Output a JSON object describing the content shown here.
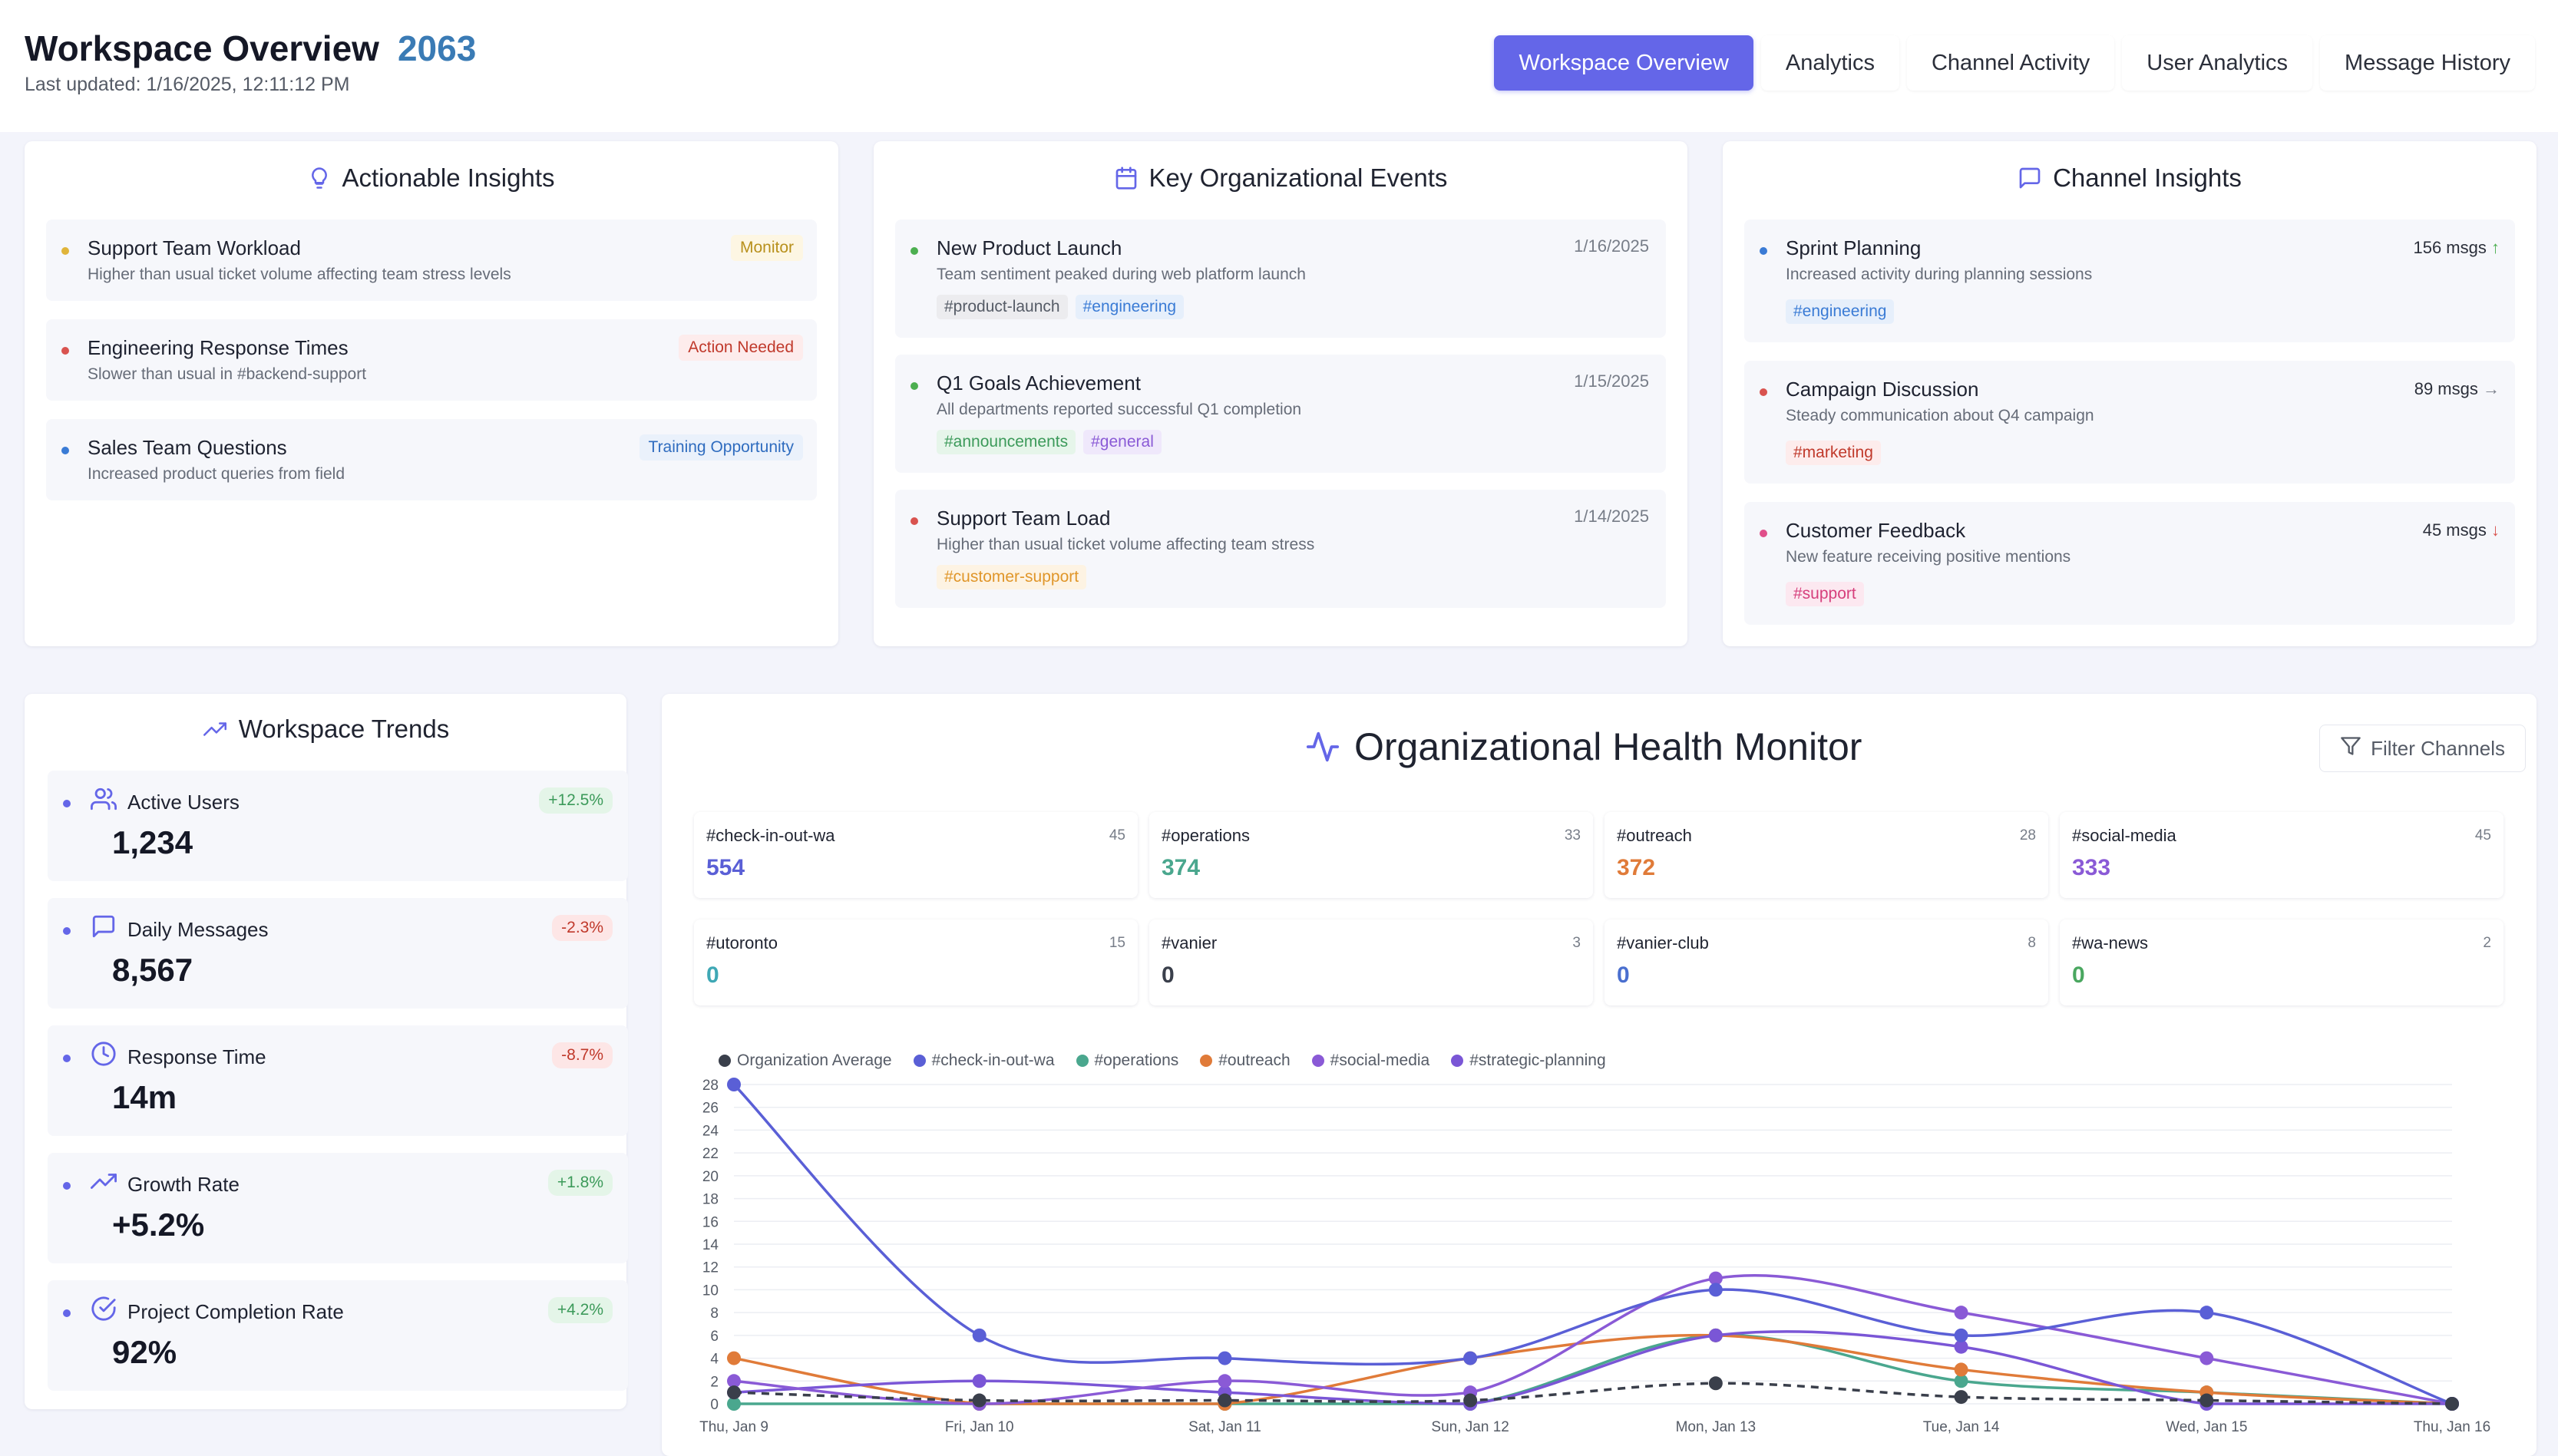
{
  "header": {
    "title": "Workspace Overview",
    "count": "2063",
    "last_updated": "Last updated: 1/16/2025, 12:11:12 PM"
  },
  "nav": {
    "tabs": [
      {
        "label": "Workspace Overview",
        "active": true
      },
      {
        "label": "Analytics",
        "active": false
      },
      {
        "label": "Channel Activity",
        "active": false
      },
      {
        "label": "User Analytics",
        "active": false
      },
      {
        "label": "Message History",
        "active": false
      }
    ]
  },
  "insights": {
    "title": "Actionable Insights",
    "icon": "lightbulb-icon",
    "items": [
      {
        "title": "Support Team Workload",
        "desc": "Higher than usual ticket volume affecting team stress levels",
        "badge": "Monitor",
        "color": "#e0b43a"
      },
      {
        "title": "Engineering Response Times",
        "desc": "Slower than usual in #backend-support",
        "badge": "Action Needed",
        "color": "#d9534f"
      },
      {
        "title": "Sales Team Questions",
        "desc": "Increased product queries from field",
        "badge": "Training Opportunity",
        "color": "#3a7bd5"
      }
    ]
  },
  "events": {
    "title": "Key Organizational Events",
    "icon": "calendar-icon",
    "items": [
      {
        "title": "New Product Launch",
        "desc": "Team sentiment peaked during web platform launch",
        "date": "1/16/2025",
        "tags": [
          "#product-launch",
          "#engineering"
        ],
        "color": "#4caf50"
      },
      {
        "title": "Q1 Goals Achievement",
        "desc": "All departments reported successful Q1 completion",
        "date": "1/15/2025",
        "tags": [
          "#announcements",
          "#general"
        ],
        "color": "#4caf50"
      },
      {
        "title": "Support Team Load",
        "desc": "Higher than usual ticket volume affecting team stress",
        "date": "1/14/2025",
        "tags": [
          "#customer-support"
        ],
        "color": "#d9534f"
      }
    ]
  },
  "channels": {
    "title": "Channel Insights",
    "icon": "message-square-icon",
    "items": [
      {
        "title": "Sprint Planning",
        "desc": "Increased activity during planning sessions",
        "msgs": "156 msgs",
        "trend": "up",
        "tag": "#engineering",
        "color": "#3a7bd5"
      },
      {
        "title": "Campaign Discussion",
        "desc": "Steady communication about Q4 campaign",
        "msgs": "89 msgs",
        "trend": "flat",
        "tag": "#marketing",
        "color": "#d9534f"
      },
      {
        "title": "Customer Feedback",
        "desc": "New feature receiving positive mentions",
        "msgs": "45 msgs",
        "trend": "down",
        "tag": "#support",
        "color": "#e04f8a"
      }
    ]
  },
  "trends": {
    "title": "Workspace Trends",
    "items": [
      {
        "label": "Active Users",
        "value": "1,234",
        "change": "+12.5%",
        "positive": true,
        "icon": "users-icon"
      },
      {
        "label": "Daily Messages",
        "value": "8,567",
        "change": "-2.3%",
        "positive": false,
        "icon": "message-icon"
      },
      {
        "label": "Response Time",
        "value": "14m",
        "change": "-8.7%",
        "positive": false,
        "icon": "clock-icon"
      },
      {
        "label": "Growth Rate",
        "value": "+5.2%",
        "change": "+1.8%",
        "positive": true,
        "icon": "trending-up-icon"
      },
      {
        "label": "Project Completion Rate",
        "value": "92%",
        "change": "+4.2%",
        "positive": true,
        "icon": "check-circle-icon"
      }
    ]
  },
  "health": {
    "title": "Organizational Health Monitor",
    "filter_label": "Filter Channels",
    "stats": [
      {
        "name": "#check-in-out-wa",
        "count": "45",
        "value": "554",
        "color": "#5a5fd6"
      },
      {
        "name": "#operations",
        "count": "33",
        "value": "374",
        "color": "#4aa78e"
      },
      {
        "name": "#outreach",
        "count": "28",
        "value": "372",
        "color": "#e07b39"
      },
      {
        "name": "#social-media",
        "count": "45",
        "value": "333",
        "color": "#8a5ad6"
      },
      {
        "name": "#utoronto",
        "count": "15",
        "value": "0",
        "color": "#3fa8b5"
      },
      {
        "name": "#vanier",
        "count": "3",
        "value": "0",
        "color": "#3a3f4b"
      },
      {
        "name": "#vanier-club",
        "count": "8",
        "value": "0",
        "color": "#4a6fcf"
      },
      {
        "name": "#wa-news",
        "count": "2",
        "value": "0",
        "color": "#4aa760"
      }
    ]
  },
  "chart_data": {
    "type": "line",
    "x": [
      "Thu, Jan 9",
      "Fri, Jan 10",
      "Sat, Jan 11",
      "Sun, Jan 12",
      "Mon, Jan 13",
      "Tue, Jan 14",
      "Wed, Jan 15",
      "Thu, Jan 16"
    ],
    "ylim": [
      0,
      28
    ],
    "yticks": [
      0,
      2,
      4,
      6,
      8,
      10,
      12,
      14,
      16,
      18,
      20,
      22,
      24,
      26,
      28
    ],
    "grid": true,
    "legend_position": "top-left",
    "series": [
      {
        "name": "Organization Average",
        "color": "#3a3f4b",
        "dashed": true,
        "values": [
          1,
          0.3,
          0.3,
          0.3,
          1.8,
          0.6,
          0.3,
          0
        ]
      },
      {
        "name": "#check-in-out-wa",
        "color": "#5a5fd6",
        "dashed": false,
        "values": [
          28,
          6,
          4,
          4,
          10,
          6,
          8,
          0
        ]
      },
      {
        "name": "#operations",
        "color": "#4aa78e",
        "dashed": false,
        "values": [
          0,
          0,
          0,
          0,
          6,
          2,
          1,
          0
        ]
      },
      {
        "name": "#outreach",
        "color": "#e07b39",
        "dashed": false,
        "values": [
          4,
          0,
          0,
          4,
          6,
          3,
          1,
          0
        ]
      },
      {
        "name": "#social-media",
        "color": "#8a5ad6",
        "dashed": false,
        "values": [
          2,
          0,
          2,
          1,
          11,
          8,
          4,
          0
        ]
      },
      {
        "name": "#strategic-planning",
        "color": "#7a56d6",
        "dashed": false,
        "values": [
          1,
          2,
          1,
          0,
          6,
          5,
          0,
          0
        ]
      }
    ]
  }
}
